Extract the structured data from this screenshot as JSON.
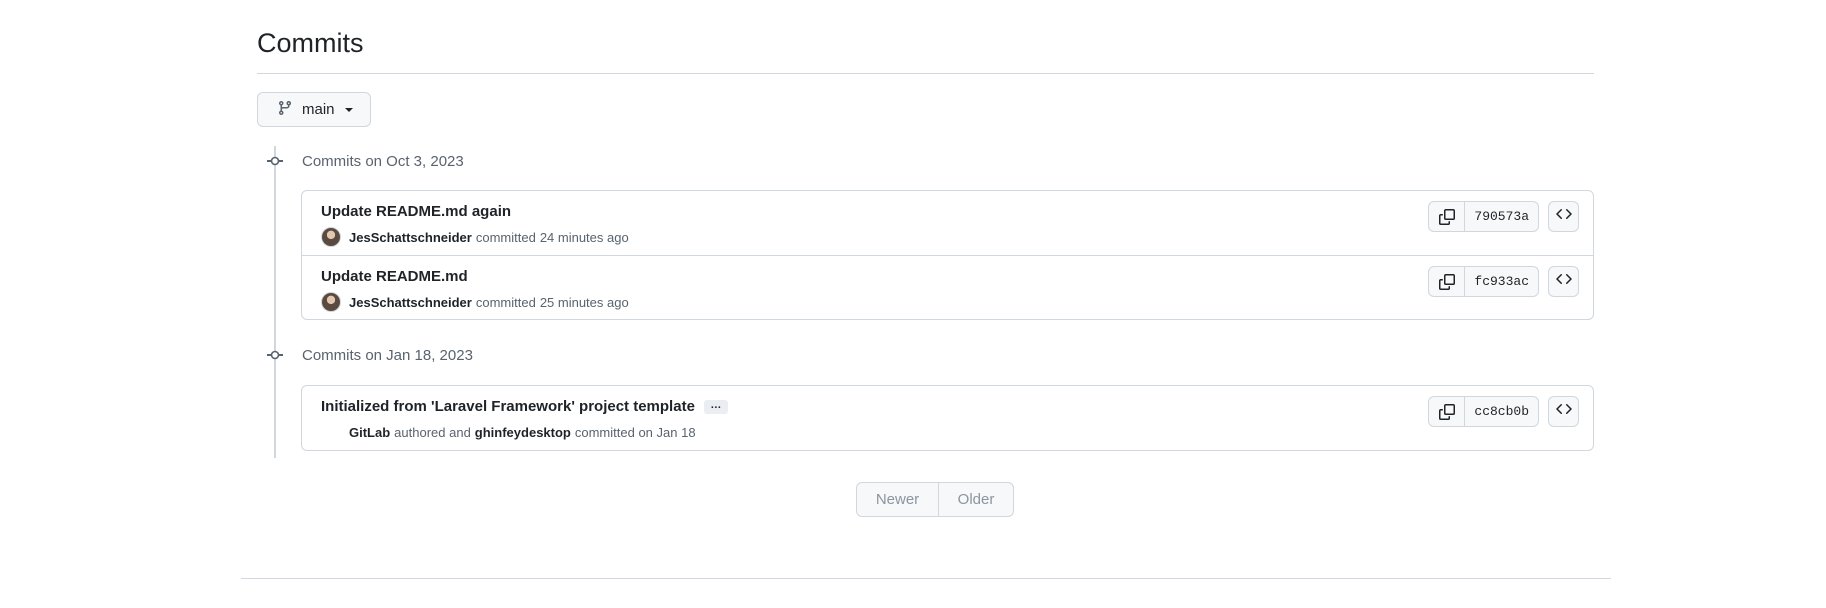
{
  "page": {
    "title": "Commits"
  },
  "branch": {
    "label": "main",
    "icon": "git-branch-icon"
  },
  "groups": [
    {
      "date_label": "Commits on Oct 3, 2023",
      "commits": [
        {
          "title": "Update README.md again",
          "author": "JesSchattschneider",
          "action": "committed",
          "time": "24 minutes ago",
          "sha": "790573a"
        },
        {
          "title": "Update README.md",
          "author": "JesSchattschneider",
          "action": "committed",
          "time": "25 minutes ago",
          "sha": "fc933ac"
        }
      ]
    },
    {
      "date_label": "Commits on Jan 18, 2023",
      "commits": [
        {
          "title": "Initialized from 'Laravel Framework' project template",
          "ellipsis": "…",
          "author": "GitLab",
          "action": "authored and",
          "committer": "ghinfeydesktop",
          "action2": "committed on Jan 18",
          "sha": "cc8cb0b"
        }
      ]
    }
  ],
  "pagination": {
    "newer": "Newer",
    "older": "Older"
  },
  "colors": {
    "border": "#d0d7de",
    "muted": "#59636e",
    "button_bg": "#f6f8fa",
    "text": "#1f2328"
  }
}
